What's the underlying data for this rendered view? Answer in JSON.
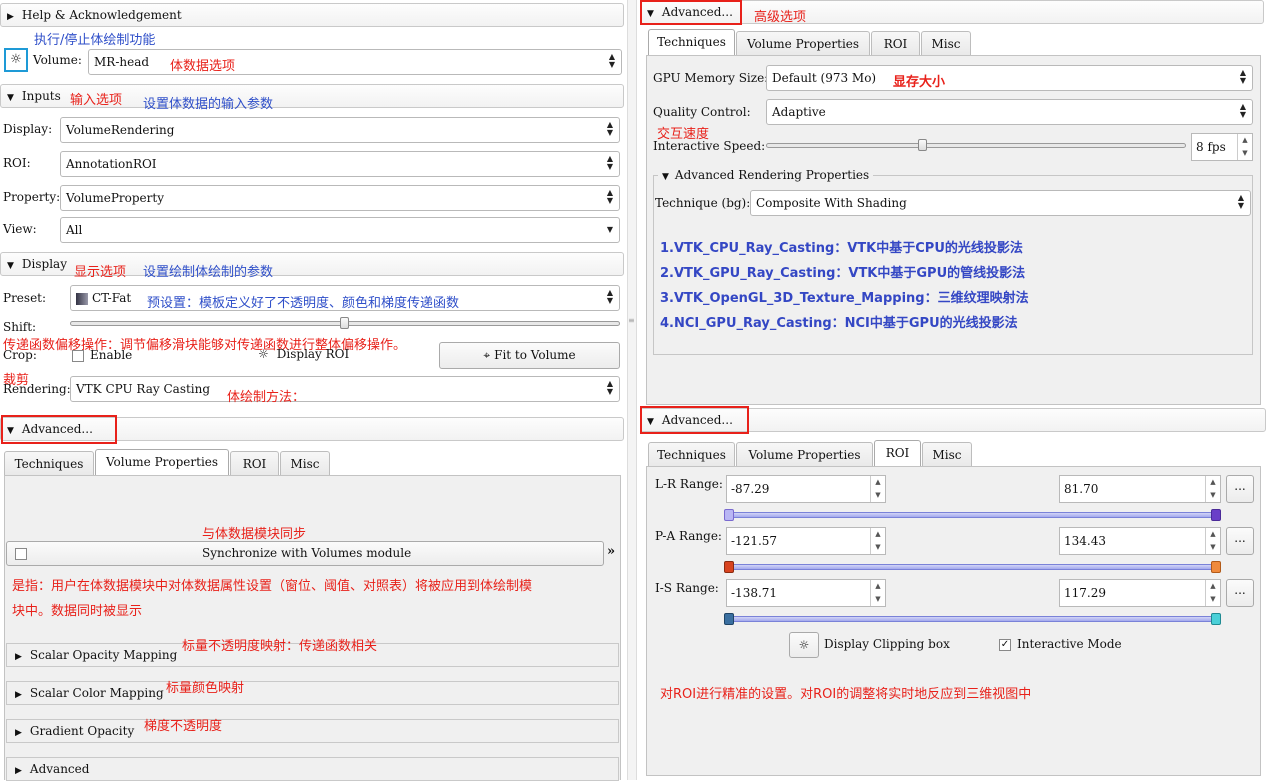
{
  "left": {
    "help_title": "Help & Acknowledgement",
    "volume_label": "Volume:",
    "volume_value": "MR-head",
    "inputs_title": "Inputs",
    "display_label": "Display:",
    "display_value": "VolumeRendering",
    "roi_label": "ROI:",
    "roi_value": "AnnotationROI",
    "property_label": "Property:",
    "property_value": "VolumeProperty",
    "view_label": "View:",
    "view_value": "All",
    "display_title": "Display",
    "preset_label": "Preset:",
    "preset_value": "CT-Fat",
    "shift_label": "Shift:",
    "crop_label": "Crop:",
    "enable_label": "Enable",
    "display_roi_label": "Display ROI",
    "fit_button": "Fit to Volume",
    "rendering_label": "Rendering:",
    "rendering_value": "VTK CPU Ray Casting",
    "advanced_title": "Advanced...",
    "tabs": [
      "Techniques",
      "Volume Properties",
      "ROI",
      "Misc"
    ],
    "sync_label": "Synchronize with Volumes module",
    "sync_more": "»",
    "scalar_opacity": "Scalar Opacity Mapping",
    "scalar_color": "Scalar Color Mapping",
    "gradient_opacity": "Gradient Opacity",
    "advanced_sub": "Advanced"
  },
  "right_top": {
    "advanced_title": "Advanced...",
    "tabs": [
      "Techniques",
      "Volume Properties",
      "ROI",
      "Misc"
    ],
    "gpu_label": "GPU Memory Size:",
    "gpu_value": "Default (973 Mo)",
    "quality_label": "Quality Control:",
    "quality_value": "Adaptive",
    "speed_label": "Interactive Speed:",
    "speed_value": "8 fps",
    "adv_render_title": "Advanced Rendering Properties",
    "technique_label": "Technique (bg):",
    "technique_value": "Composite With Shading",
    "methods": [
      "1.VTK_CPU_Ray_Casting：VTK中基于CPU的光线投影法",
      "2.VTK_GPU_Ray_Casting：VTK中基于GPU的管线投影法",
      "3.VTK_OpenGL_3D_Texture_Mapping：三维纹理映射法",
      "4.NCI_GPU_Ray_Casting：NCI中基于GPU的光线投影法"
    ]
  },
  "right_bottom": {
    "advanced_title": "Advanced...",
    "tabs": [
      "Techniques",
      "Volume Properties",
      "ROI",
      "Misc"
    ],
    "lr_label": "L-R Range:",
    "lr_min": "-87.29",
    "lr_max": "81.70",
    "pa_label": "P-A Range:",
    "pa_min": "-121.57",
    "pa_max": "134.43",
    "is_label": "I-S Range:",
    "is_min": "-138.71",
    "is_max": "117.29",
    "more": "...",
    "clip_label": "Display Clipping box",
    "interactive_label": "Interactive Mode",
    "check": "✓"
  },
  "annotations": {
    "toggle_volume": "执行/停止体绘制功能",
    "volume_option": "体数据选项",
    "input_option": "输入选项",
    "input_desc": "设置体数据的输入参数",
    "display_option": "显示选项",
    "display_desc": "设置绘制体绘制的参数",
    "preset_desc": "预设置：模板定义好了不透明度、颜色和梯度传递函数",
    "shift_desc": "传递函数偏移操作：调节偏移滑块能够对传递函数进行整体偏移操作。",
    "crop_desc": "裁剪",
    "rendering_desc": "体绘制方法：",
    "sync_title": "与体数据模块同步",
    "sync_desc_1": "是指：用户在体数据模块中对体数据属性设置（窗位、阈值、对照表）将被应用到体绘制模",
    "sync_desc_2": "块中。数据同时被显示",
    "scalar_opacity_desc": "标量不透明度映射：传递函数相关",
    "scalar_color_desc": "标量颜色映射",
    "gradient_desc": "梯度不透明度",
    "advanced_option": "高级选项",
    "gpu_desc": "显存大小",
    "speed_desc": "交互速度",
    "roi_desc": "对ROI进行精准的设置。对ROI的调整将实时地反应到三维视图中"
  },
  "colors": {
    "annotation_red": "#e8211a",
    "annotation_blue": "#2f4fc9",
    "highlight_box": "#1e9ad6"
  }
}
